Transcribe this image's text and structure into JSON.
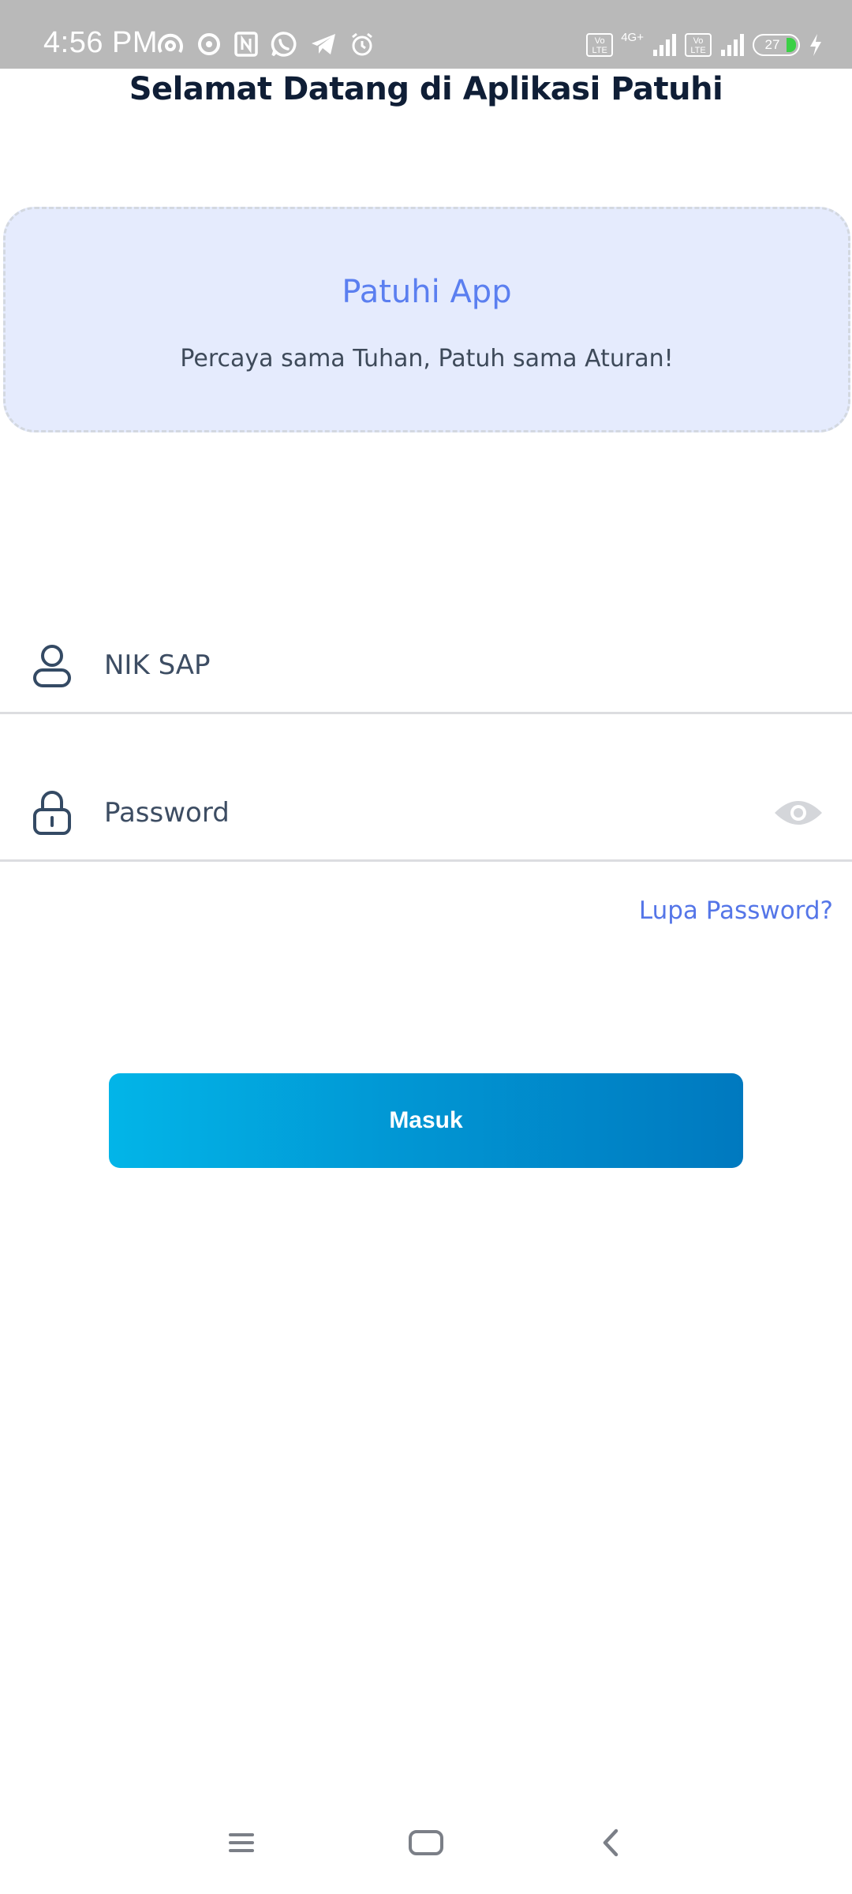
{
  "status_bar": {
    "time": "4:56 PM",
    "network_label": "4G+",
    "volte_label": "Vo LTE",
    "battery_level": "27",
    "left_icons": [
      "hotspot-icon",
      "sync-icon",
      "nfc-icon",
      "whatsapp-icon",
      "telegram-icon",
      "alarm-icon"
    ],
    "right_icons": [
      "volte-icon",
      "signal-icon",
      "volte-icon",
      "signal-icon",
      "battery-icon",
      "charging-icon"
    ]
  },
  "header": {
    "title": "Selamat Datang di Aplikasi Patuhi"
  },
  "banner": {
    "title": "Patuhi App",
    "subtitle": "Percaya sama Tuhan, Patuh sama Aturan!"
  },
  "form": {
    "nik_placeholder": "NIK SAP",
    "nik_value": "",
    "password_placeholder": "Password",
    "password_value": "",
    "forgot_password": "Lupa Password?",
    "submit_label": "Masuk"
  },
  "nav_bar": {
    "icons": [
      "menu-icon",
      "home-icon",
      "back-icon"
    ]
  },
  "colors": {
    "status_bar": "#b9b9b9",
    "banner_bg": "#e5ebfd",
    "banner_title": "#5b7ff0",
    "link": "#5576e8",
    "button_start": "#02b5e8",
    "button_end": "#0079bf",
    "title_text": "#0f1e36"
  }
}
